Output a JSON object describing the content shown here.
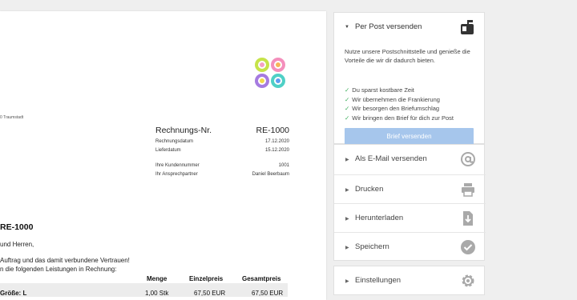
{
  "invoice": {
    "sender_line": "0 Traumstadt",
    "number_label": "Rechnungs-Nr.",
    "number_value": "RE-1000",
    "meta_rows": [
      {
        "label": "Rechnungsdatum",
        "value": "17.12.2020"
      },
      {
        "label": "Lieferdatum",
        "value": "15.12.2020"
      }
    ],
    "meta_rows2": [
      {
        "label": "Ihre Kundennummer",
        "value": "1001"
      },
      {
        "label": "Ihr Ansprechpartner",
        "value": "Daniel Beerbaum"
      }
    ],
    "title": "RE-1000",
    "greeting": "und Herren,",
    "line1": "Auftrag und das damit verbundene Vertrauen!",
    "line2": "n die folgenden Leistungen in Rechnung:",
    "table": {
      "headers": [
        "Menge",
        "Einzelpreis",
        "Gesamtpreis"
      ],
      "first_col_header": "",
      "rows": [
        {
          "desc": "Größe: L",
          "qty": "1,00 Stk",
          "unit": "67,50 EUR",
          "total": "67,50 EUR"
        }
      ]
    }
  },
  "post": {
    "title": "Per Post versenden",
    "description": "Nutze unsere Postschnittstelle und genieße die Vorteile die wir dir dadurch bieten.",
    "benefits": [
      "Du sparst kostbare Zeit",
      "Wir übernehmen die Frankierung",
      "Wir besorgen den Briefumschlag",
      "Wir bringen den Brief für dich zur Post"
    ],
    "button_label": "Brief versenden",
    "icon": "mailbox-icon"
  },
  "actions": [
    {
      "label": "Als E-Mail versenden",
      "icon": "at-icon"
    },
    {
      "label": "Drucken",
      "icon": "printer-icon"
    },
    {
      "label": "Herunterladen",
      "icon": "download-icon"
    },
    {
      "label": "Speichern",
      "icon": "checkmark-circle-icon"
    }
  ],
  "settings": {
    "label": "Einstellungen",
    "icon": "gear-icon"
  },
  "colors": {
    "accent_button": "#a6c6ec",
    "check_green": "#3cae5b",
    "icon_gray": "#a9a9a9"
  }
}
